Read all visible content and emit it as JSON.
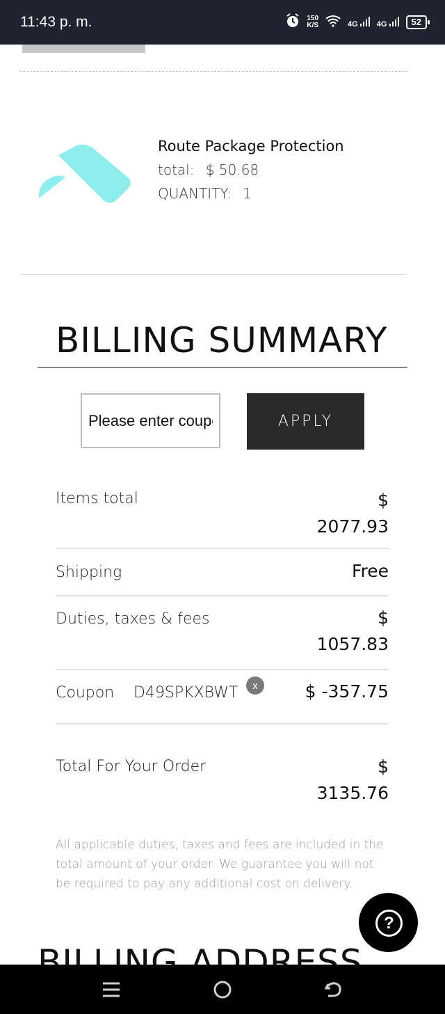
{
  "status_bar": {
    "time": "11:43 p. m.",
    "speed_value": "150",
    "speed_unit": "K/S",
    "network_1": "4G",
    "network_2": "4G",
    "battery": "52",
    "icons": [
      "alarm-icon",
      "wifi-icon",
      "signal-icon",
      "signal-icon",
      "battery-icon"
    ]
  },
  "product": {
    "name": "Route Package Protection",
    "total_label": "total:",
    "total_value": "$ 50.68",
    "quantity_label": "QUANTITY:",
    "quantity_value": "1",
    "logo_color": "#8eeeee"
  },
  "billing_summary": {
    "title": "BILLING SUMMARY",
    "coupon_placeholder": "Please enter coupon code",
    "apply_label": "APPLY",
    "rows": {
      "items_total": {
        "label": "Items total",
        "currency": "$",
        "value": "2077.93"
      },
      "shipping": {
        "label": "Shipping",
        "value": "Free"
      },
      "duties": {
        "label": "Duties, taxes & fees",
        "currency": "$",
        "value": "1057.83"
      },
      "coupon": {
        "label": "Coupon",
        "code": "D49SPKXBWT",
        "remove": "x",
        "value": "$ -357.75"
      },
      "total": {
        "label": "Total For Your Order",
        "currency": "$",
        "value": "3135.76"
      }
    },
    "disclaimer": "All applicable duties, taxes and fees are included in the total amount of your order. We guarantee you will not be required to pay any additional cost on delivery."
  },
  "billing_address": {
    "title": "BILLING ADDRESS"
  },
  "help": {
    "icon": "?"
  },
  "colors": {
    "status_bar": "#1f2430",
    "button_dark": "#2a2a2a",
    "accent_logo": "#8eeeee"
  }
}
